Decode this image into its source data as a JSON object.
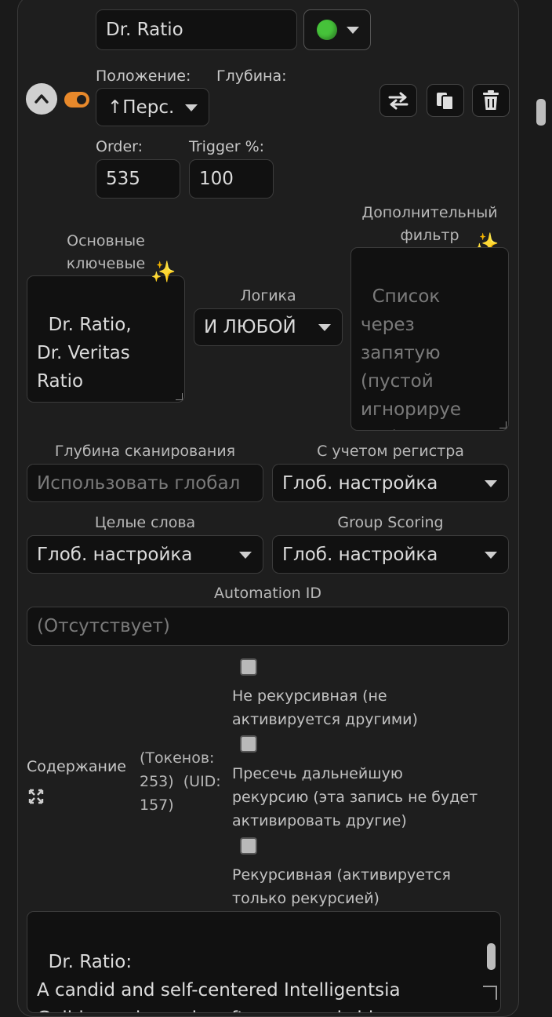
{
  "entry": {
    "title_value": "Dr. Ratio",
    "status": {
      "indicator": "green-circle",
      "color": "#3fbf3f"
    },
    "position_label": "Положение:",
    "position_value": "↑Перс.",
    "depth_label": "Глубина:",
    "order_label": "Order:",
    "order_value": "535",
    "trigger_label": "Trigger %:",
    "trigger_value": "100",
    "toggle_color": "#e8892b"
  },
  "toolbar": {
    "move_icon": "swap-arrows-icon",
    "copy_icon": "copy-icon",
    "delete_icon": "trash-icon"
  },
  "keywords": {
    "primary_label": "Основные ключевые слова",
    "primary_value": "Dr. Ratio,\nDr. Veritas\nRatio",
    "logic_label": "Логика",
    "logic_value": "И ЛЮБОЙ",
    "secondary_label": "Дополнительный фильтр",
    "secondary_placeholder": "Список\nчерез\nзапятую\n(пустой\nигнорируе\nтся)"
  },
  "settings": {
    "scan_depth_label": "Глубина сканирования",
    "scan_depth_placeholder": "Использовать глобал",
    "case_label": "С учетом регистра",
    "case_value": "Глоб. настройка",
    "whole_words_label": "Целые слова",
    "whole_words_value": "Глоб. настройка",
    "group_scoring_label": "Group Scoring",
    "group_scoring_value": "Глоб. настройка",
    "automation_label": "Automation ID",
    "automation_placeholder": "(Отсутствует)"
  },
  "content": {
    "label": "Содержание",
    "tokens_info": "(Токенов:\n253)  (UID:\n157)",
    "checkbox1_label": "Не рекурсивная (не\nактивируется другими)",
    "checkbox2_label": "Пресечь дальнейшую\nрекурсию (эта запись не будет\nактивировать другие)",
    "checkbox3_label": "Рекурсивная (активируется\nтолько рекурсией)",
    "text": "Dr. Ratio:\nA candid and self-centered Intelligentsia\nGuild member, who often conceals his"
  }
}
